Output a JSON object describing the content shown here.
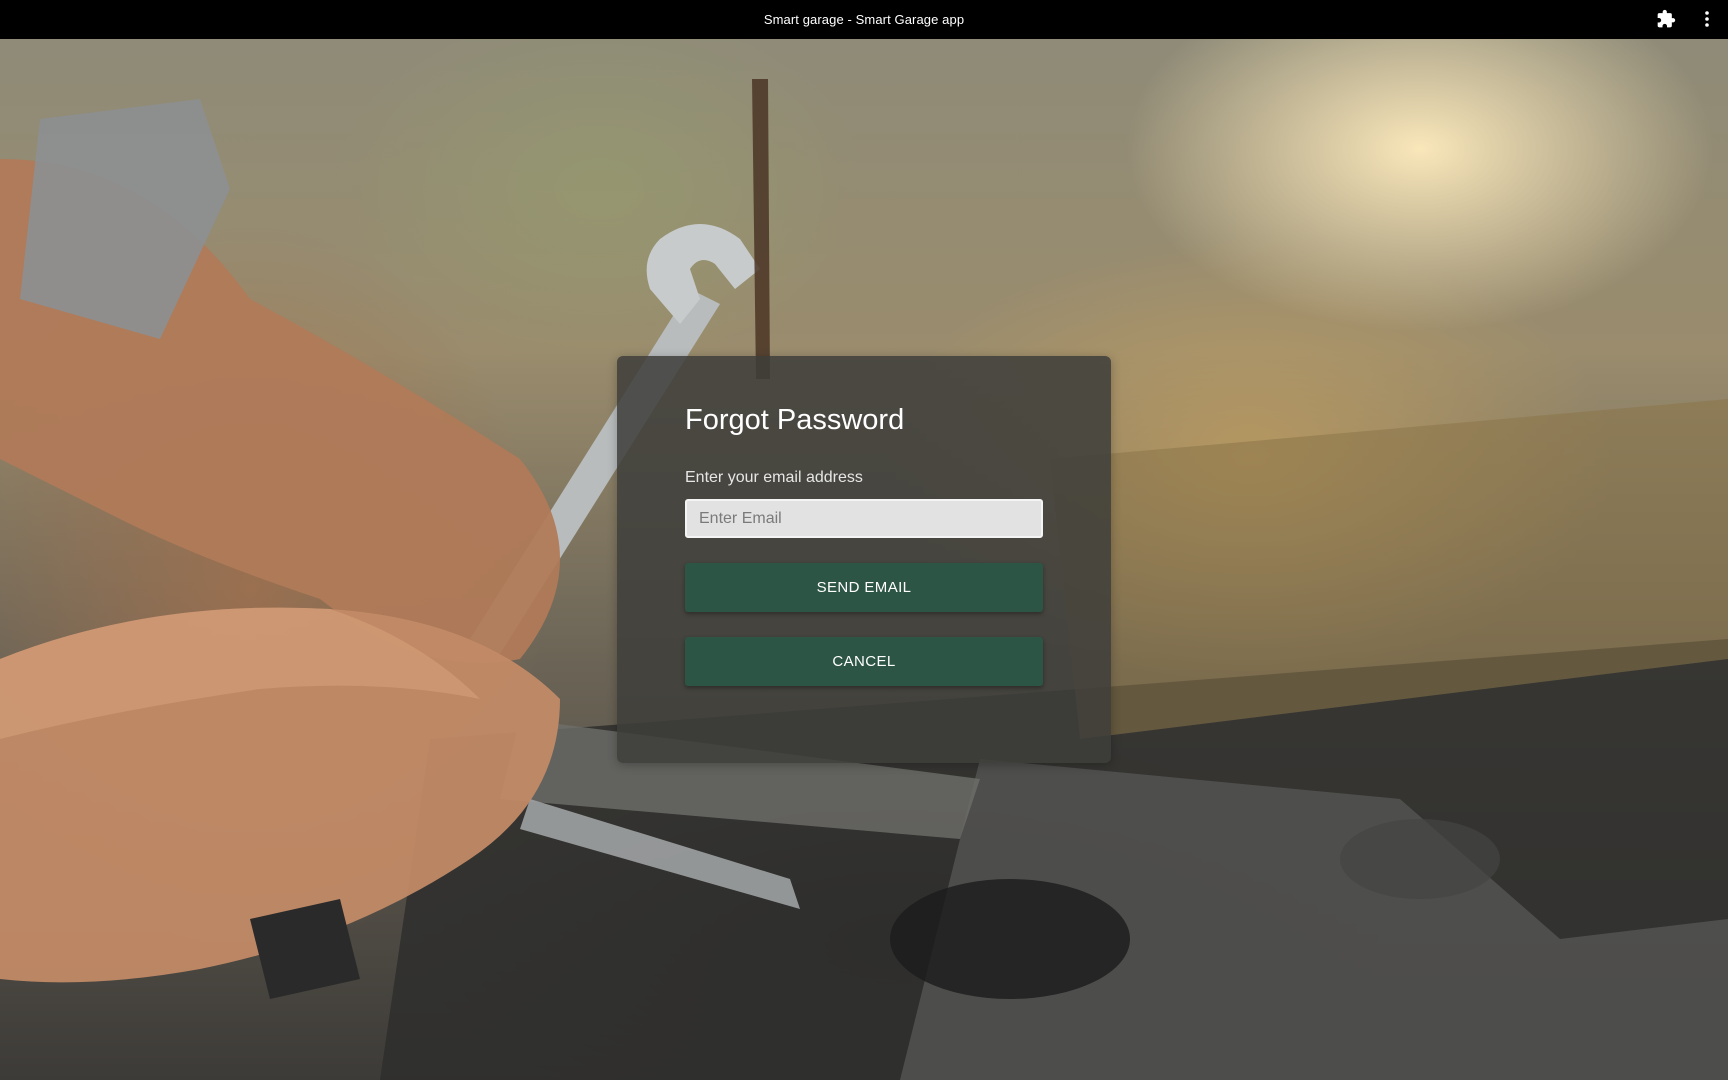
{
  "window": {
    "title": "Smart garage - Smart Garage app",
    "extension_icon": "puzzle-piece-icon",
    "menu_icon": "vertical-ellipsis-icon"
  },
  "background": {
    "description_icon": "mechanic-working-on-engine-photo"
  },
  "forgot_password": {
    "title": "Forgot Password",
    "email_label": "Enter your email address",
    "email_placeholder": "Enter Email",
    "email_value": "",
    "send_button_label": "SEND EMAIL",
    "cancel_button_label": "CANCEL"
  },
  "colors": {
    "titlebar": "#000000",
    "card": "#3e3e3a",
    "button": "#2c5545",
    "button_text": "#ffffff"
  }
}
